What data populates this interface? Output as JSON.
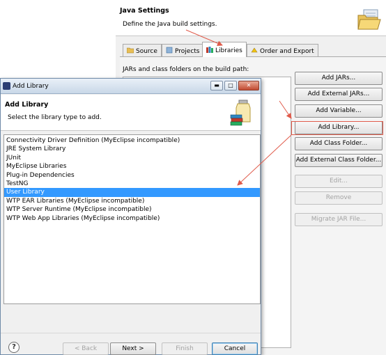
{
  "background_wizard": {
    "title": "Java Settings",
    "description": "Define the Java build settings.",
    "tabs": [
      {
        "label": "Source",
        "icon": "source-folder-icon"
      },
      {
        "label": "Projects",
        "icon": "projects-icon"
      },
      {
        "label": "Libraries",
        "icon": "libraries-icon",
        "active": true
      },
      {
        "label": "Order and Export",
        "icon": "order-export-icon"
      }
    ],
    "build_path_label": "JARs and class folders on the build path:",
    "buttons": {
      "add_jars": "Add JARs...",
      "add_external_jars": "Add External JARs...",
      "add_variable": "Add Variable...",
      "add_library": "Add Library...",
      "add_class_folder": "Add Class Folder...",
      "add_external_class_folder": "Add External Class Folder...",
      "edit": "Edit...",
      "remove": "Remove",
      "migrate_jar": "Migrate JAR File..."
    }
  },
  "dialog": {
    "window_title": "Add Library",
    "heading": "Add Library",
    "subtitle": "Select the library type to add.",
    "library_types": [
      "Connectivity Driver Definition (MyEclipse incompatible)",
      "JRE System Library",
      "JUnit",
      "MyEclipse Libraries",
      "Plug-in Dependencies",
      "TestNG",
      "User Library",
      "WTP EAR Libraries (MyEclipse incompatible)",
      "WTP Server Runtime (MyEclipse incompatible)",
      "WTP Web App Libraries (MyEclipse incompatible)"
    ],
    "selected_index": 6,
    "buttons": {
      "help": "?",
      "back": "< Back",
      "next": "Next >",
      "finish": "Finish",
      "cancel": "Cancel"
    }
  },
  "colors": {
    "selection": "#3399ff",
    "annotation": "#e05b4b"
  }
}
